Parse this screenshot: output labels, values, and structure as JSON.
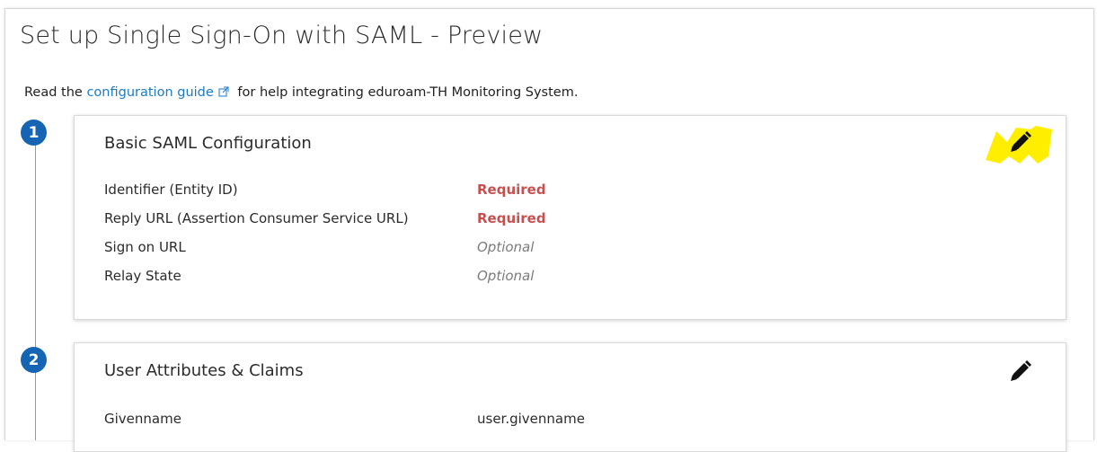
{
  "page": {
    "title": "Set up Single Sign-On with SAML - Preview",
    "intro_prefix": "Read the ",
    "intro_link": "configuration guide",
    "intro_suffix": " for help integrating eduroam-TH Monitoring System."
  },
  "steps": [
    {
      "number": "1",
      "title": "Basic SAML Configuration",
      "rows": [
        {
          "label": "Identifier (Entity ID)",
          "value": "Required",
          "status": "required"
        },
        {
          "label": "Reply URL (Assertion Consumer Service URL)",
          "value": "Required",
          "status": "required"
        },
        {
          "label": "Sign on URL",
          "value": "Optional",
          "status": "optional"
        },
        {
          "label": "Relay State",
          "value": "Optional",
          "status": "optional"
        }
      ],
      "edit_icon": "pencil-icon",
      "highlight_color": "#ffee00"
    },
    {
      "number": "2",
      "title": "User Attributes & Claims",
      "rows": [
        {
          "label": "Givenname",
          "value": "user.givenname",
          "status": "plain"
        }
      ],
      "edit_icon": "pencil-icon"
    }
  ],
  "colors": {
    "link": "#1a7ac9",
    "required": "#c94f4f",
    "optional": "#7a7a7a",
    "step_badge": "#1565b4"
  }
}
